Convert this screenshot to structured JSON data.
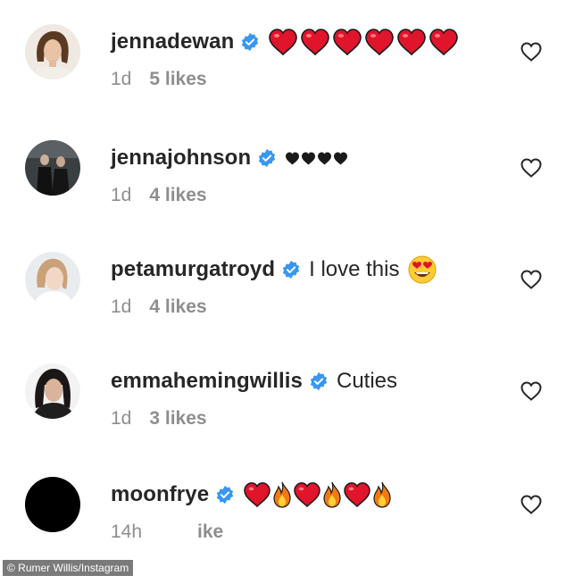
{
  "comments": [
    {
      "username": "jennadewan",
      "text": "",
      "emojis": [
        "red-heart",
        "red-heart",
        "red-heart",
        "red-heart",
        "red-heart",
        "red-heart"
      ],
      "time": "1d",
      "likes": "5 likes"
    },
    {
      "username": "jennajohnson",
      "text": "",
      "emojis": [
        "black-heart",
        "black-heart",
        "black-heart",
        "black-heart"
      ],
      "time": "1d",
      "likes": "4 likes"
    },
    {
      "username": "petamurgatroyd",
      "text": "I love this",
      "emojis": [
        "heart-eyes-face"
      ],
      "time": "1d",
      "likes": "4 likes"
    },
    {
      "username": "emmahemingwillis",
      "text": "Cuties",
      "emojis": [],
      "time": "1d",
      "likes": "3 likes"
    },
    {
      "username": "moonfrye",
      "text": "",
      "emojis": [
        "red-heart",
        "fire",
        "red-heart",
        "fire",
        "red-heart",
        "fire"
      ],
      "time": "14h",
      "likes": "ike"
    }
  ],
  "credit": "© Rumer Willis/Instagram",
  "colors": {
    "verified": "#3897f0",
    "red_heart": "#e0142b",
    "meta_text": "#8e8e8e",
    "username": "#262626"
  },
  "icons": {
    "verified": "verified-badge-icon",
    "like": "heart-outline-icon"
  }
}
